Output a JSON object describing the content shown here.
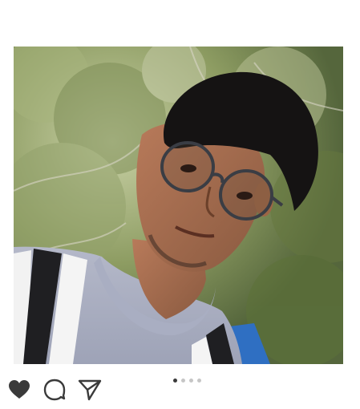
{
  "post": {
    "photo": {
      "alt": "",
      "description": ""
    },
    "actions": [
      {
        "name": "like",
        "icon": "heart-icon"
      },
      {
        "name": "comment",
        "icon": "comment-icon"
      },
      {
        "name": "share",
        "icon": "send-icon"
      }
    ],
    "carousel": {
      "total": 4,
      "active_index": 0
    }
  },
  "colors": {
    "icon": "#3a3a3a",
    "dot_active": "#3a3a3a",
    "dot_inactive": "#c6c6c6"
  }
}
